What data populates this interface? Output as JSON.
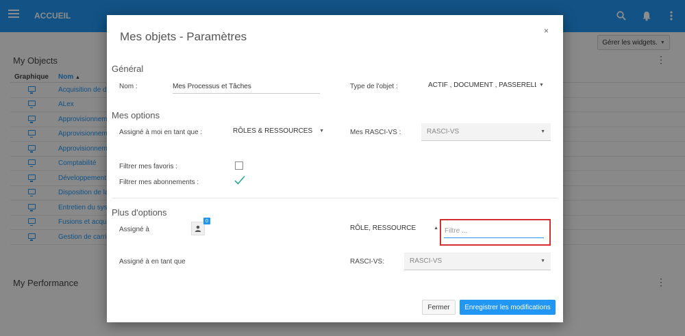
{
  "topbar": {
    "title": "ACCUEIL"
  },
  "background": {
    "objects_title": "My Objects",
    "performance_title": "My Performance",
    "widgets_button": "Gérer les widgets.",
    "table": {
      "col_graphique": "Graphique",
      "col_nom": "Nom",
      "rows": [
        "Acquisition de de",
        "ALex",
        "Approvisionneme",
        "Approvisionneme",
        "Approvisionneme",
        "Comptabilité",
        "Développement d",
        "Disposition de la",
        "Entretien du syst",
        "Fusions et acquis",
        "Gestion de carriè"
      ]
    }
  },
  "modal": {
    "title": "Mes objets - Paramètres",
    "close": "×",
    "general": {
      "heading": "Général",
      "name_label": "Nom :",
      "name_value": "Mes Processus et Tâches",
      "type_label": "Type de l'objet :",
      "type_value": "ACTIF , DOCUMENT , PASSERELLE , IN"
    },
    "options": {
      "heading": "Mes options",
      "assigned_label": "Assigné à moi en tant que :",
      "assigned_value": "RÔLES & RESSOURCES",
      "rasci_label": "Mes RASCI-VS :",
      "rasci_value": "RASCI-VS",
      "fav_label": "Filtrer mes favoris :",
      "sub_label": "Filtrer mes abonnements :",
      "fav_checked": false,
      "sub_checked": true
    },
    "more": {
      "heading": "Plus d'options",
      "assigned_to_label": "Assigné à",
      "badge_count": "0",
      "role_value": "RÔLE, RESSOURCE",
      "filter_placeholder": "Filtre ...",
      "as_label": "Assigné à en tant que",
      "rasci_label": "RASCI-VS:",
      "rasci_value": "RASCI-VS"
    },
    "buttons": {
      "close": "Fermer",
      "save": "Enregistrer les modifications"
    }
  },
  "icons": {
    "menu": "menu-icon",
    "search": "search-icon",
    "bell": "bell-icon",
    "more": "more-vert-icon",
    "user": "user-icon",
    "monitor": "monitor-icon",
    "check": "check-icon"
  },
  "colors": {
    "primary": "#2196f3",
    "highlight": "#d32f2f",
    "check": "#26a69a"
  }
}
